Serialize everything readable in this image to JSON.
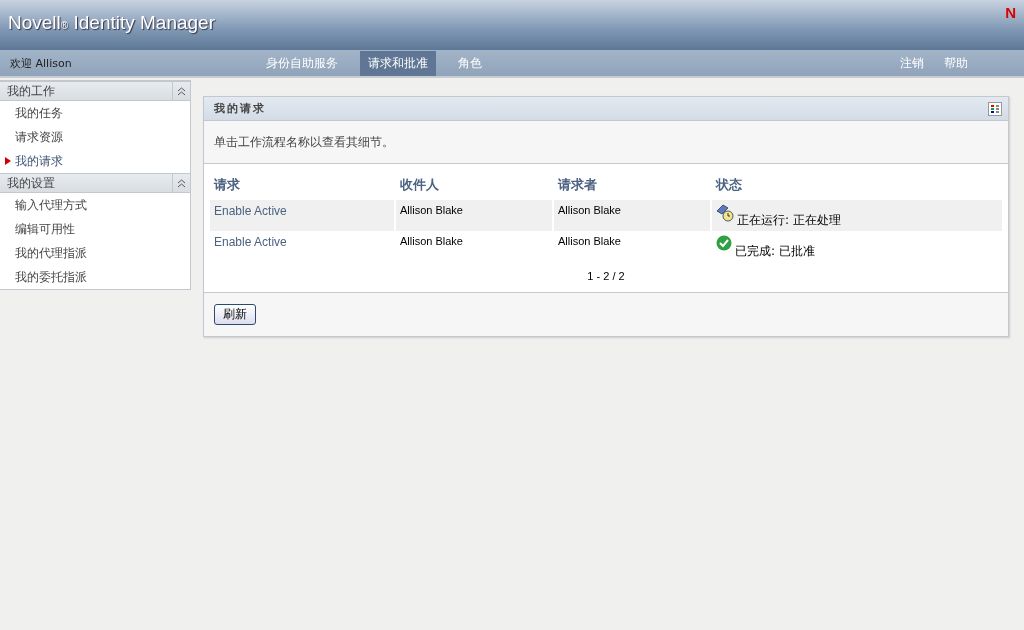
{
  "header": {
    "brand": "Novell",
    "registered": "®",
    "product": "Identity Manager",
    "logo_letter": "N"
  },
  "nav": {
    "welcome": "欢迎 Allison",
    "tabs": [
      {
        "label": "身份自助服务",
        "selected": false
      },
      {
        "label": "请求和批准",
        "selected": true
      },
      {
        "label": "角色",
        "selected": false
      }
    ],
    "links": [
      "注销",
      "帮助"
    ]
  },
  "sidebar": {
    "sections": [
      {
        "title": "我的工作",
        "expanded": true,
        "items": [
          {
            "label": "我的任务",
            "selected": false
          },
          {
            "label": "请求资源",
            "selected": false
          },
          {
            "label": "我的请求",
            "selected": true
          }
        ]
      },
      {
        "title": "我的设置",
        "expanded": true,
        "items": [
          {
            "label": "输入代理方式",
            "selected": false
          },
          {
            "label": "编辑可用性",
            "selected": false
          },
          {
            "label": "我的代理指派",
            "selected": false
          },
          {
            "label": "我的委托指派",
            "selected": false
          }
        ]
      }
    ]
  },
  "panel": {
    "title": "我的请求",
    "instruction": "单击工作流程名称以查看其细节。",
    "table": {
      "columns": [
        "请求",
        "收件人",
        "请求者",
        "状态"
      ],
      "rows": [
        {
          "request": "Enable Active",
          "recipient": "Allison Blake",
          "requester": "Allison Blake",
          "kind": "running",
          "status": "正在运行: 正在处理"
        },
        {
          "request": "Enable Active",
          "recipient": "Allison Blake",
          "requester": "Allison Blake",
          "kind": "completed",
          "status": "已完成: 已批准"
        }
      ]
    },
    "pagination": "1 - 2 / 2",
    "refresh_button": "刷新"
  }
}
